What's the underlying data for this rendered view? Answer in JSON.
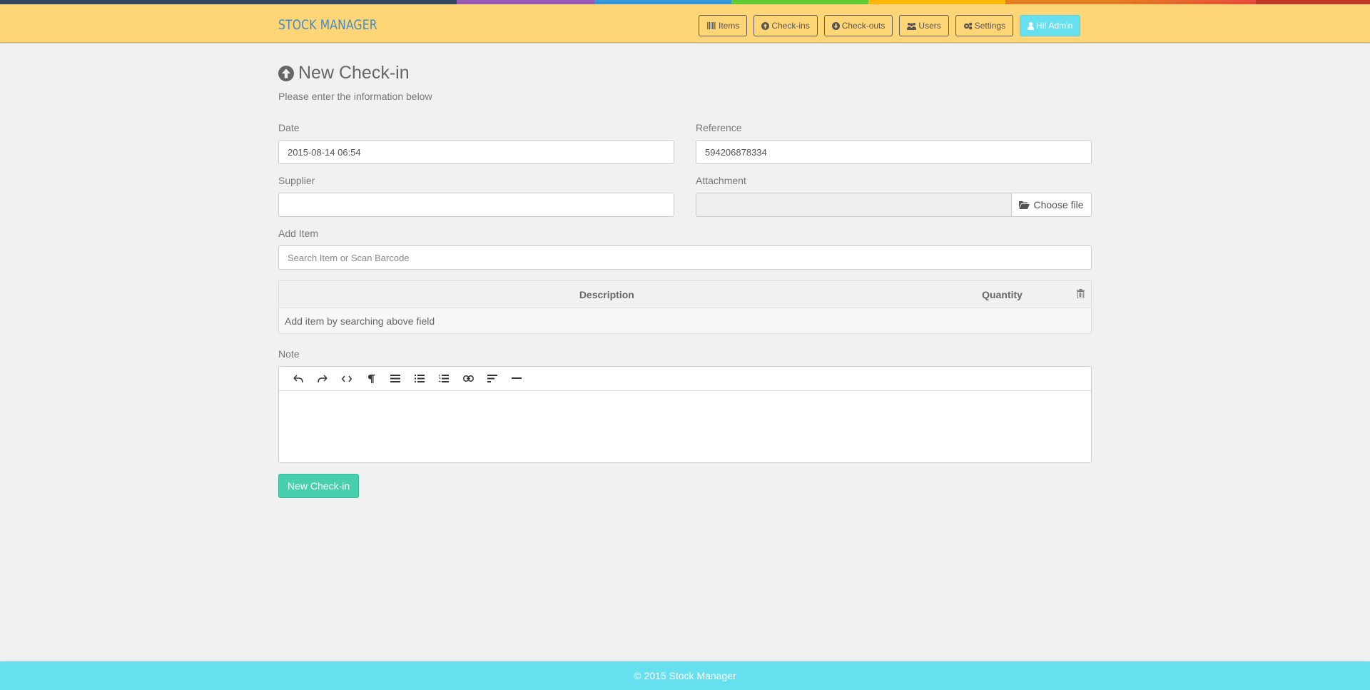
{
  "theme": {
    "rainbow": [
      "#34495e",
      "#34495e",
      "#9b59b6",
      "#3498db",
      "#62cb31",
      "#ffb606",
      "#e67e22",
      "#e74c3c",
      "#c0392b"
    ],
    "navbar_bg": "#ffd677",
    "brand_color": "#428bca",
    "accent_admin": "#66e0ef",
    "submit_color": "#48cfad"
  },
  "navbar": {
    "brand": "STOCK MANAGER",
    "items": [
      {
        "label": "Items",
        "icon": "barcode-icon"
      },
      {
        "label": "Check-ins",
        "icon": "arrow-circle-up-icon"
      },
      {
        "label": "Check-outs",
        "icon": "arrow-circle-down-icon"
      },
      {
        "label": "Users",
        "icon": "users-icon"
      },
      {
        "label": "Settings",
        "icon": "gears-icon"
      },
      {
        "label": "Hi! Admin",
        "icon": "user-icon"
      }
    ]
  },
  "page": {
    "title": "New Check-in",
    "title_icon": "arrow-circle-up-icon",
    "subtitle": "Please enter the information below"
  },
  "form": {
    "date": {
      "label": "Date",
      "value": "2015-08-14 06:54"
    },
    "reference": {
      "label": "Reference",
      "value": "594206878334"
    },
    "supplier": {
      "label": "Supplier",
      "value": ""
    },
    "attachment": {
      "label": "Attachment",
      "button": "Choose file",
      "icon": "folder-open-icon"
    },
    "add_item": {
      "label": "Add Item",
      "placeholder": "Search Item or Scan Barcode"
    },
    "table": {
      "columns": [
        "Description",
        "Quantity"
      ],
      "delete_icon": "trash-icon",
      "empty_message": "Add item by searching above field"
    },
    "note": {
      "label": "Note",
      "toolbar": [
        "undo-icon",
        "redo-icon",
        "code-icon",
        "paragraph-icon",
        "align-icon",
        "unordered-list-icon",
        "ordered-list-icon",
        "link-icon",
        "align-left-icon",
        "horizontal-rule-icon"
      ]
    },
    "submit": "New Check-in"
  },
  "footer": {
    "text": "© 2015 Stock Manager"
  }
}
